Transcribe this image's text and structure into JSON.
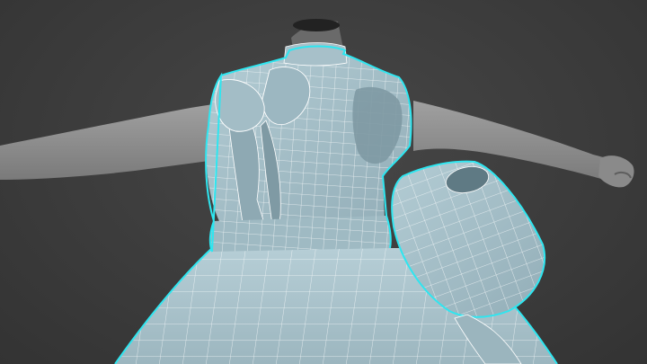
{
  "viewport": {
    "background_color": "#3c3c3c",
    "body_color": "#8f8f8f",
    "garment_color": "#a9c3cc",
    "garment_shadow_color": "#6f8a94",
    "wireframe_color": "#ffffff",
    "selection_outline_color": "#2ee6f0"
  },
  "scene": {
    "objects": [
      {
        "name": "body-mesh",
        "selected": false
      },
      {
        "name": "dress-mesh",
        "selected": true
      }
    ],
    "parts": [
      "head-stump",
      "left-arm",
      "right-arm",
      "right-hand",
      "collar",
      "bow",
      "bodice",
      "waistband",
      "skirt",
      "puff-sleeve"
    ]
  }
}
